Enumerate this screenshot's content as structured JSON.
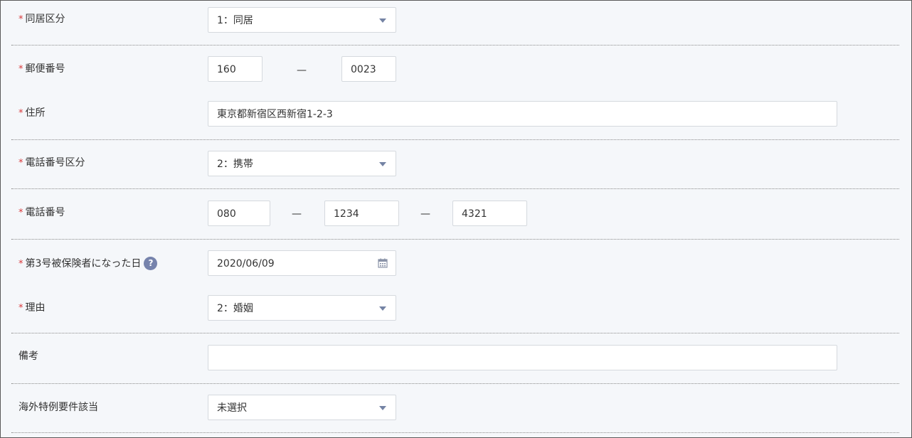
{
  "required_mark": "*",
  "dash": "—",
  "fields": {
    "cohabitation": {
      "label": "同居区分",
      "value": "1：同居"
    },
    "postal": {
      "label": "郵便番号",
      "part1": "160",
      "part2": "0023"
    },
    "address": {
      "label": "住所",
      "value": "東京都新宿区西新宿1-2-3"
    },
    "phone_type": {
      "label": "電話番号区分",
      "value": "2：携帯"
    },
    "phone": {
      "label": "電話番号",
      "part1": "080",
      "part2": "1234",
      "part3": "4321"
    },
    "dependent_date": {
      "label": "第3号被保険者になった日",
      "help": "?",
      "value": "2020/06/09"
    },
    "reason": {
      "label": "理由",
      "value": "2：婚姻"
    },
    "remarks": {
      "label": "備考",
      "value": ""
    },
    "overseas": {
      "label": "海外特例要件該当",
      "value": "未選択"
    }
  }
}
